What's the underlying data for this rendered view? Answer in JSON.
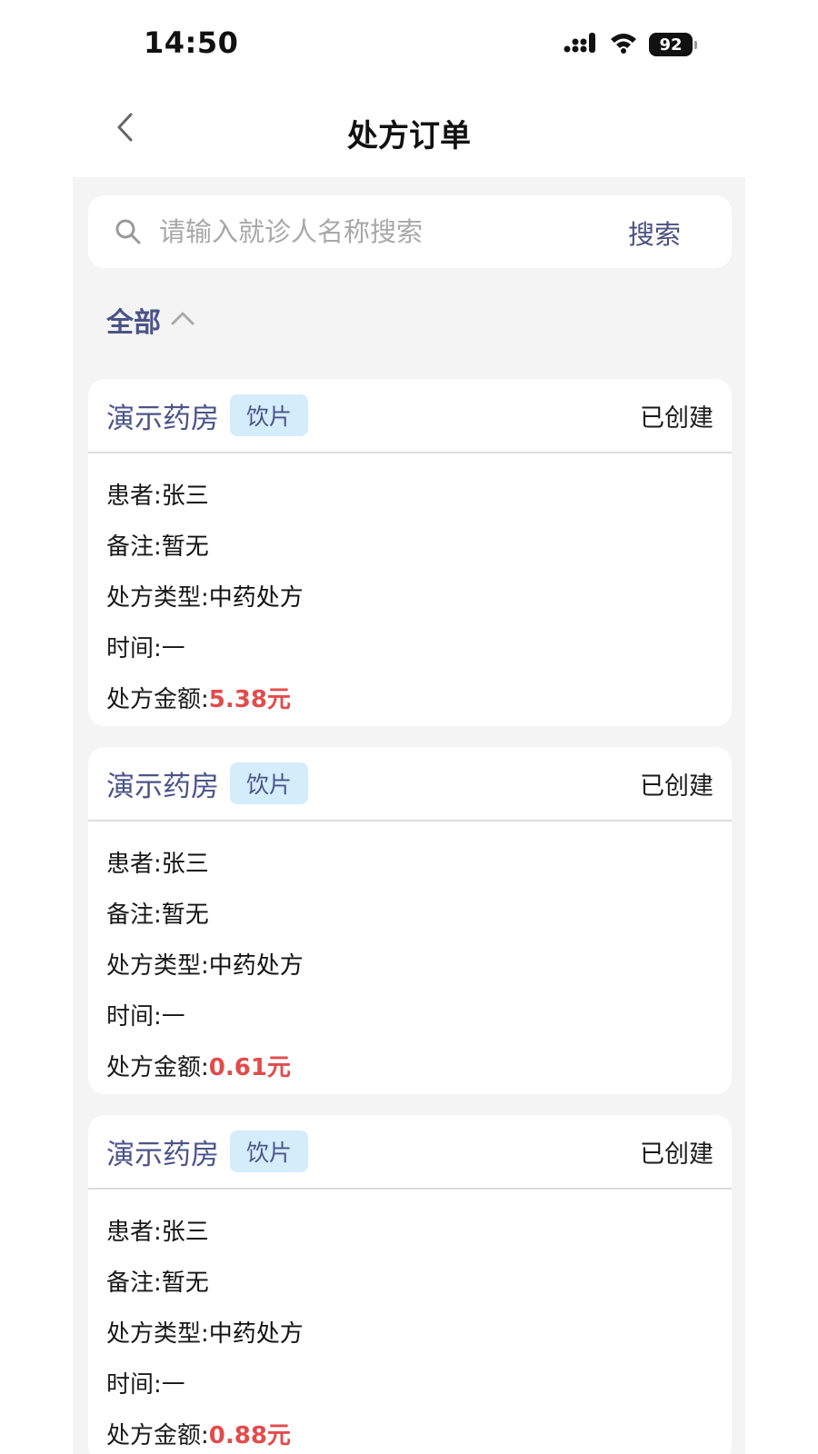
{
  "status_bar": {
    "time": "14:50",
    "battery": "92",
    "icons": [
      "signal-icon",
      "wifi-icon",
      "battery-icon"
    ]
  },
  "nav": {
    "title": "处方订单",
    "back_icon": "chevron-left-icon"
  },
  "search": {
    "placeholder": "请输入就诊人名称搜索",
    "button_label": "搜索",
    "icon": "search-icon"
  },
  "filter": {
    "label": "全部",
    "icon": "chevron-up-icon"
  },
  "labels": {
    "patient": "患者:",
    "remark": "备注:",
    "rx_type": "处方类型:",
    "time": "时间:",
    "amount": "处方金额:"
  },
  "orders": [
    {
      "pharmacy": "演示药房",
      "tag": "饮片",
      "status": "已创建",
      "patient": "张三",
      "remark": "暂无",
      "rx_type": "中药处方",
      "time": "—",
      "amount": "5.38元"
    },
    {
      "pharmacy": "演示药房",
      "tag": "饮片",
      "status": "已创建",
      "patient": "张三",
      "remark": "暂无",
      "rx_type": "中药处方",
      "time": "—",
      "amount": "0.61元"
    },
    {
      "pharmacy": "演示药房",
      "tag": "饮片",
      "status": "已创建",
      "patient": "张三",
      "remark": "暂无",
      "rx_type": "中药处方",
      "time": "—",
      "amount": "0.88元"
    }
  ],
  "colors": {
    "accent": "#4a5488",
    "amount": "#e24b4b",
    "tag_bg": "#d5ecfb",
    "page_bg": "#f4f4f4"
  }
}
